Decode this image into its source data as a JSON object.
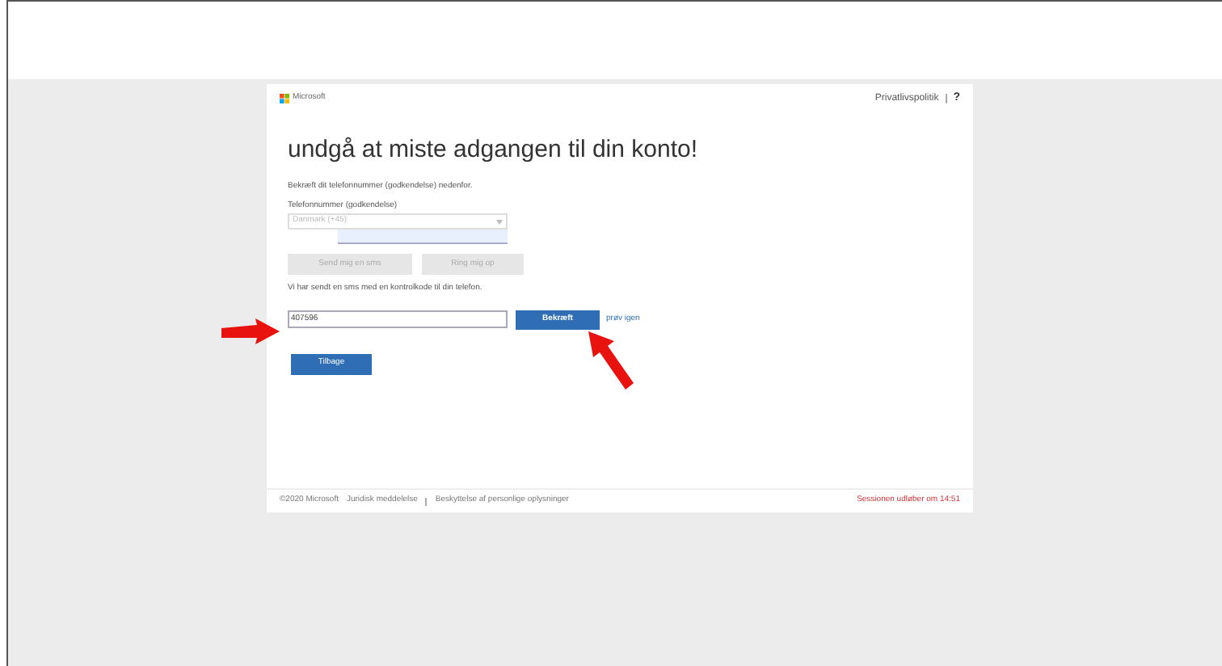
{
  "header": {
    "logo_text": "Microsoft",
    "links": [
      "Privatlivspolitik",
      "?"
    ]
  },
  "title": "undgå at miste adgangen til din konto!",
  "intro": "Bekræft dit telefonnummer (godkendelse) nedenfor.",
  "phone": {
    "label": "Telefonnummer (godkendelse)",
    "country": "Danmark (+45)",
    "disabled": true
  },
  "send_buttons": [
    {
      "label": "Send mig en sms",
      "disabled": true
    },
    {
      "label": "Ring mig op",
      "disabled": true
    }
  ],
  "sent_note": "Vi har sendt en sms med en kontrolkode til din telefon.",
  "code": {
    "value": "407596"
  },
  "verify_button": "Bekræft",
  "retry_link": "prøv igen",
  "back_button": "Tilbage",
  "footer": {
    "copyright": "©2020 Microsoft",
    "links": [
      "Juridisk meddelelse",
      "Beskyttelse af personlige oplysninger"
    ],
    "session": "Sessionen udløber om 14:51"
  }
}
